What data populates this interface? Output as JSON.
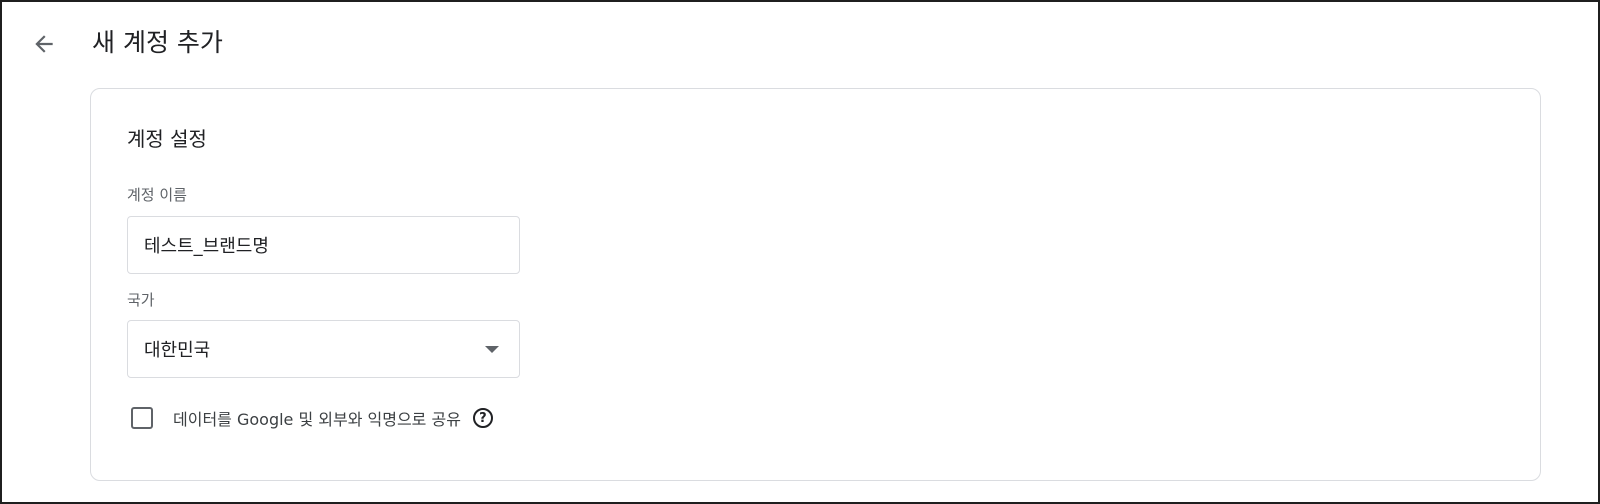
{
  "header": {
    "back_icon": "arrow-back-icon",
    "title": "새 계정 추가"
  },
  "account_settings": {
    "title": "계정 설정",
    "account_name": {
      "label": "계정 이름",
      "value": "테스트_브랜드명"
    },
    "country": {
      "label": "국가",
      "selected": "대한민국",
      "icon": "arrow-drop-down-icon"
    },
    "data_sharing": {
      "label": "데이터를 Google 및 외부와 익명으로 공유",
      "checked": false,
      "help_icon": "help-circle-icon",
      "help_glyph": "?"
    }
  },
  "colors": {
    "text_primary": "#202124",
    "text_secondary": "#5f6368",
    "border": "#dadce0"
  }
}
